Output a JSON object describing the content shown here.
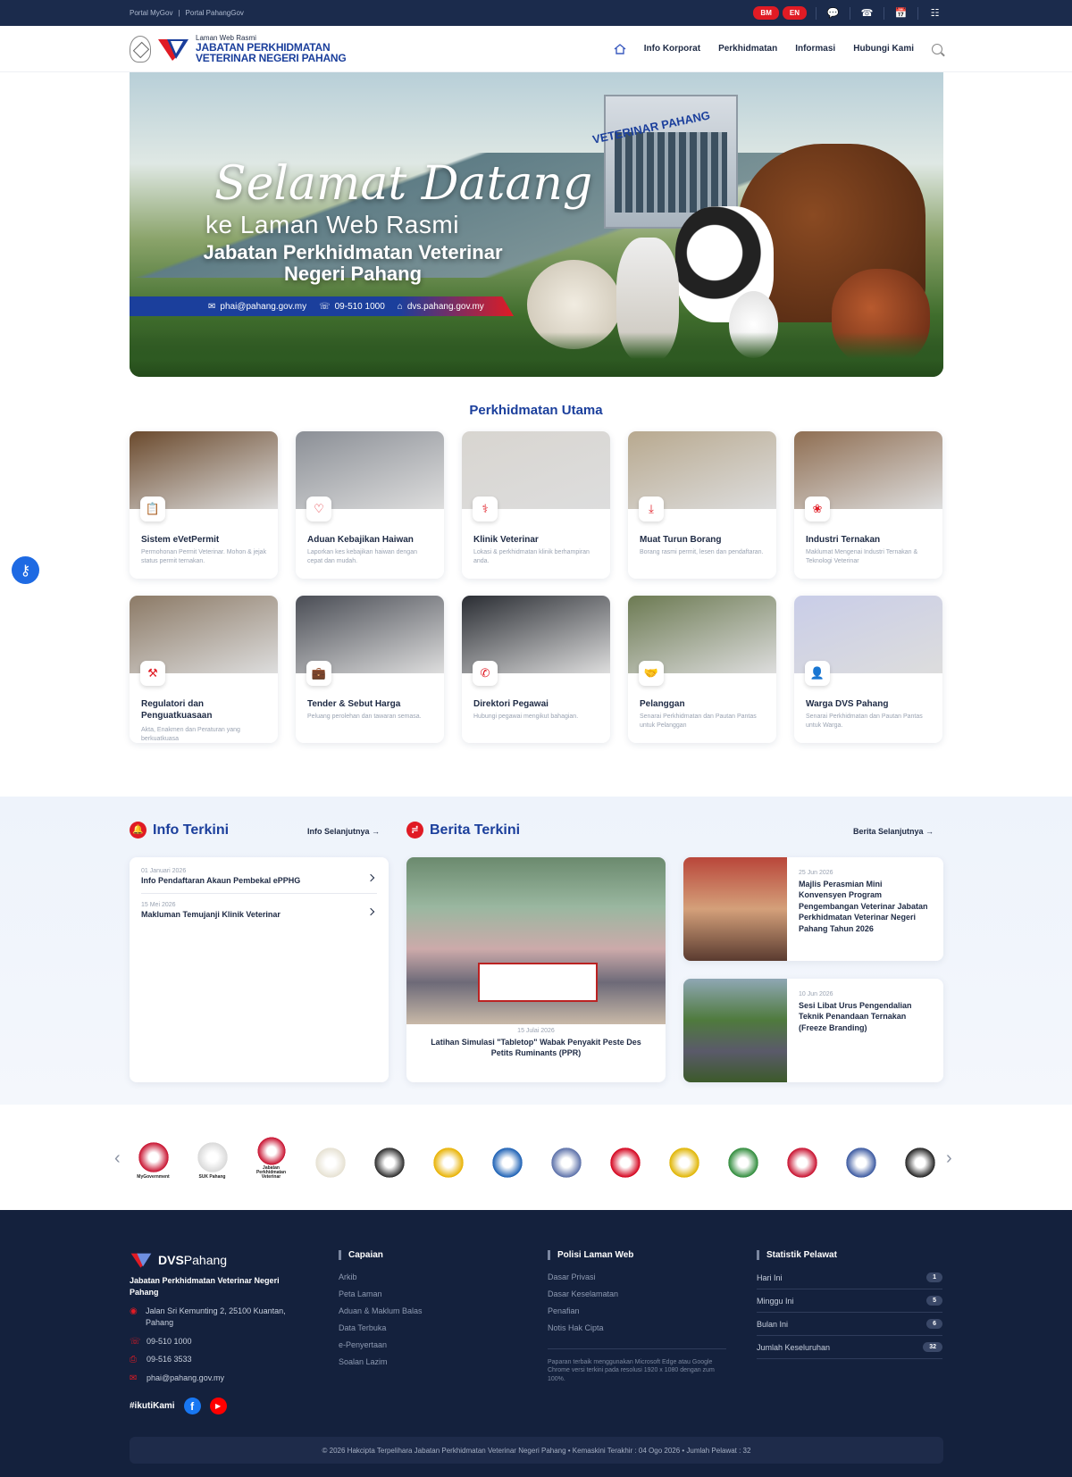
{
  "topbar": {
    "links": [
      "Portal MyGov",
      "|",
      "Portal PahangGov"
    ],
    "lang_bm": "BM",
    "lang_en": "EN"
  },
  "header": {
    "logo_small": "Laman Web Rasmi",
    "logo_line1": "JABATAN PERKHIDMATAN",
    "logo_line2": "VETERINAR NEGERI PAHANG",
    "nav": [
      "Info Korporat",
      "Perkhidmatan",
      "Informasi",
      "Hubungi Kami"
    ]
  },
  "hero": {
    "script": "Selamat Datang",
    "sub": "ke Laman Web Rasmi",
    "title": "Jabatan Perkhidmatan Veterinar Negeri Pahang",
    "building_sign": "VETERINAR PAHANG",
    "email": "phai@pahang.gov.my",
    "phone": "09-510 1000",
    "web": "dvs.pahang.gov.my"
  },
  "services": {
    "title": "Perkhidmatan Utama",
    "items": [
      {
        "title": "Sistem eVetPermit",
        "desc": "Permohonan Permit Veterinar. Mohon & jejak status permit ternakan.",
        "icon": "clipboard-icon",
        "color": "#6b4a2d"
      },
      {
        "title": "Aduan Kebajikan Haiwan",
        "desc": "Laporkan kes kebajikan haiwan dengan cepat dan mudah.",
        "icon": "heart-icon",
        "color": "#8b8f96"
      },
      {
        "title": "Klinik Veterinar",
        "desc": "Lokasi & perkhidmatan klinik berhampiran anda.",
        "icon": "stethoscope-icon",
        "color": "#d8d5d0"
      },
      {
        "title": "Muat Turun Borang",
        "desc": "Borang rasmi permit, lesen dan pendaftaran.",
        "icon": "download-icon",
        "color": "#b8a98f"
      },
      {
        "title": "Industri Ternakan",
        "desc": "Maklumat Mengenai Industri Ternakan & Teknologi Veterinar",
        "icon": "paw-icon",
        "color": "#8f6e52"
      },
      {
        "title": "Regulatori dan Penguatkuasaan",
        "desc": "Akta, Enakmen dan Peraturan yang berkuatkuasa",
        "icon": "gavel-icon",
        "color": "#8c7a66"
      },
      {
        "title": "Tender & Sebut Harga",
        "desc": "Peluang perolehan dan tawaran semasa.",
        "icon": "briefcase-icon",
        "color": "#4a4d55"
      },
      {
        "title": "Direktori Pegawai",
        "desc": "Hubungi pegawai mengikut bahagian.",
        "icon": "phone-icon",
        "color": "#2a2d33"
      },
      {
        "title": "Pelanggan",
        "desc": "Senarai Perkhidmatan dan Pautan Pantas untuk Pelanggan",
        "icon": "handshake-icon",
        "color": "#6c7a52"
      },
      {
        "title": "Warga DVS Pahang",
        "desc": "Senarai Perkhidmatan dan Pautan Pantas untuk Warga.",
        "icon": "id-card-icon",
        "color": "#c9cde8"
      }
    ]
  },
  "info": {
    "title": "Info Terkini",
    "more": "Info Selanjutnya",
    "items": [
      {
        "date": "01 Januari 2026",
        "title": "Info Pendaftaran Akaun Pembekal ePPHG"
      },
      {
        "date": "15 Mei 2026",
        "title": "Makluman Temujanji Klinik Veterinar"
      }
    ]
  },
  "news": {
    "title": "Berita Terkini",
    "more": "Berita Selanjutnya",
    "main": {
      "date": "15 Julai 2026",
      "title": "Latihan Simulasi \"Tabletop\" Wabak Penyakit Peste Des Petits Ruminants (PPR)"
    },
    "side": [
      {
        "date": "25 Jun 2026",
        "title": "Majlis Perasmian Mini Konvensyen Program Pengembangan Veterinar Jabatan Perkhidmatan Veterinar Negeri Pahang Tahun 2026"
      },
      {
        "date": "10 Jun 2026",
        "title": "Sesi Libat Urus Pengendalian Teknik Penandaan Ternakan (Freeze Branding)"
      }
    ]
  },
  "logos": [
    {
      "label": "MyGovernment",
      "color": "#c8102e"
    },
    {
      "label": "SUK Pahang",
      "color": "#d9d9d9"
    },
    {
      "label": "Jabatan Perkhidmatan Veterinar",
      "color": "#c8102e"
    },
    {
      "label": "",
      "color": "#e6e1d2"
    },
    {
      "label": "",
      "color": "#2b2b2b"
    },
    {
      "label": "",
      "color": "#e8b100"
    },
    {
      "label": "",
      "color": "#1a5fb4"
    },
    {
      "label": "",
      "color": "#5a6fa8"
    },
    {
      "label": "",
      "color": "#d4001b"
    },
    {
      "label": "",
      "color": "#e0b400"
    },
    {
      "label": "",
      "color": "#2e8b3a"
    },
    {
      "label": "",
      "color": "#c8102e"
    },
    {
      "label": "",
      "color": "#3a58a0"
    },
    {
      "label": "",
      "color": "#222"
    }
  ],
  "footer": {
    "brand_a": "DVS",
    "brand_b": "Pahang",
    "org": "Jabatan Perkhidmatan Veterinar Negeri Pahang",
    "address": "Jalan Sri Kemunting 2, 25100 Kuantan, Pahang",
    "phone": "09-510 1000",
    "fax": "09-516 3533",
    "email": "phai@pahang.gov.my",
    "follow": "#ikutiKami",
    "capaian_title": "Capaian",
    "capaian": [
      "Arkib",
      "Peta Laman",
      "Aduan & Maklum Balas",
      "Data Terbuka",
      "e-Penyertaan",
      "Soalan Lazim"
    ],
    "polisi_title": "Polisi Laman Web",
    "polisi": [
      "Dasar Privasi",
      "Dasar Keselamatan",
      "Penafian",
      "Notis Hak Cipta"
    ],
    "note": "Paparan terbaik menggunakan Microsoft Edge atau Google Chrome versi terkini pada resolusi 1920 x 1080 dengan zum 100%.",
    "stat_title": "Statistik Pelawat",
    "stats": [
      {
        "label": "Hari Ini",
        "value": "1"
      },
      {
        "label": "Minggu Ini",
        "value": "5"
      },
      {
        "label": "Bulan Ini",
        "value": "6"
      },
      {
        "label": "Jumlah Keseluruhan",
        "value": "32"
      }
    ],
    "copyright": "© 2026 Hakcipta Terpelihara Jabatan Perkhidmatan Veterinar Negeri Pahang • Kemaskini Terakhir : 04 Ogo 2026 • Jumlah Pelawat : 32"
  }
}
